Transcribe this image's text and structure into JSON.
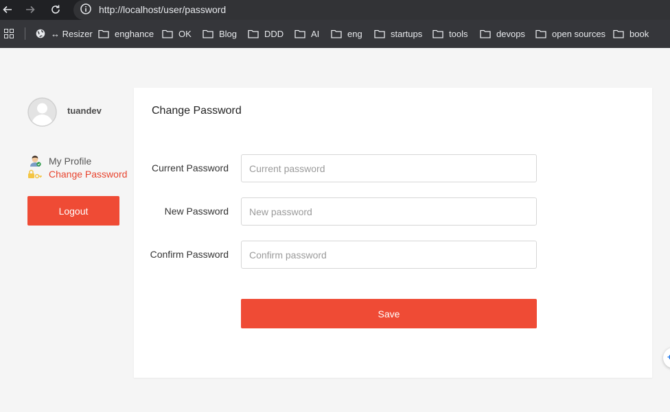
{
  "browser": {
    "url": "http://localhost/user/password",
    "bookmarks": [
      {
        "label": "↔ Resizer",
        "icon": "globe-icon"
      },
      {
        "label": "enghance",
        "icon": "folder-icon"
      },
      {
        "label": "OK",
        "icon": "folder-icon"
      },
      {
        "label": "Blog",
        "icon": "folder-icon"
      },
      {
        "label": "DDD",
        "icon": "folder-icon"
      },
      {
        "label": "AI",
        "icon": "folder-icon"
      },
      {
        "label": "eng",
        "icon": "folder-icon"
      },
      {
        "label": "startups",
        "icon": "folder-icon"
      },
      {
        "label": "tools",
        "icon": "folder-icon"
      },
      {
        "label": "devops",
        "icon": "folder-icon"
      },
      {
        "label": "open sources",
        "icon": "folder-icon"
      },
      {
        "label": "book",
        "icon": "folder-icon"
      }
    ]
  },
  "sidebar": {
    "username": "tuandev",
    "menu": [
      {
        "label": "My Profile",
        "icon": "user-profile-icon",
        "active": false
      },
      {
        "label": "Change Password",
        "icon": "key-lock-icon",
        "active": true
      }
    ],
    "logout_label": "Logout"
  },
  "form": {
    "title": "Change Password",
    "fields": [
      {
        "label": "Current Password",
        "placeholder": "Current password"
      },
      {
        "label": "New Password",
        "placeholder": "New password"
      },
      {
        "label": "Confirm Password",
        "placeholder": "Confirm password"
      }
    ],
    "save_label": "Save"
  },
  "colors": {
    "accent": "#ef4b35",
    "active_menu": "#e8442e",
    "text": "#333333",
    "page_bg": "#f5f5f5"
  }
}
